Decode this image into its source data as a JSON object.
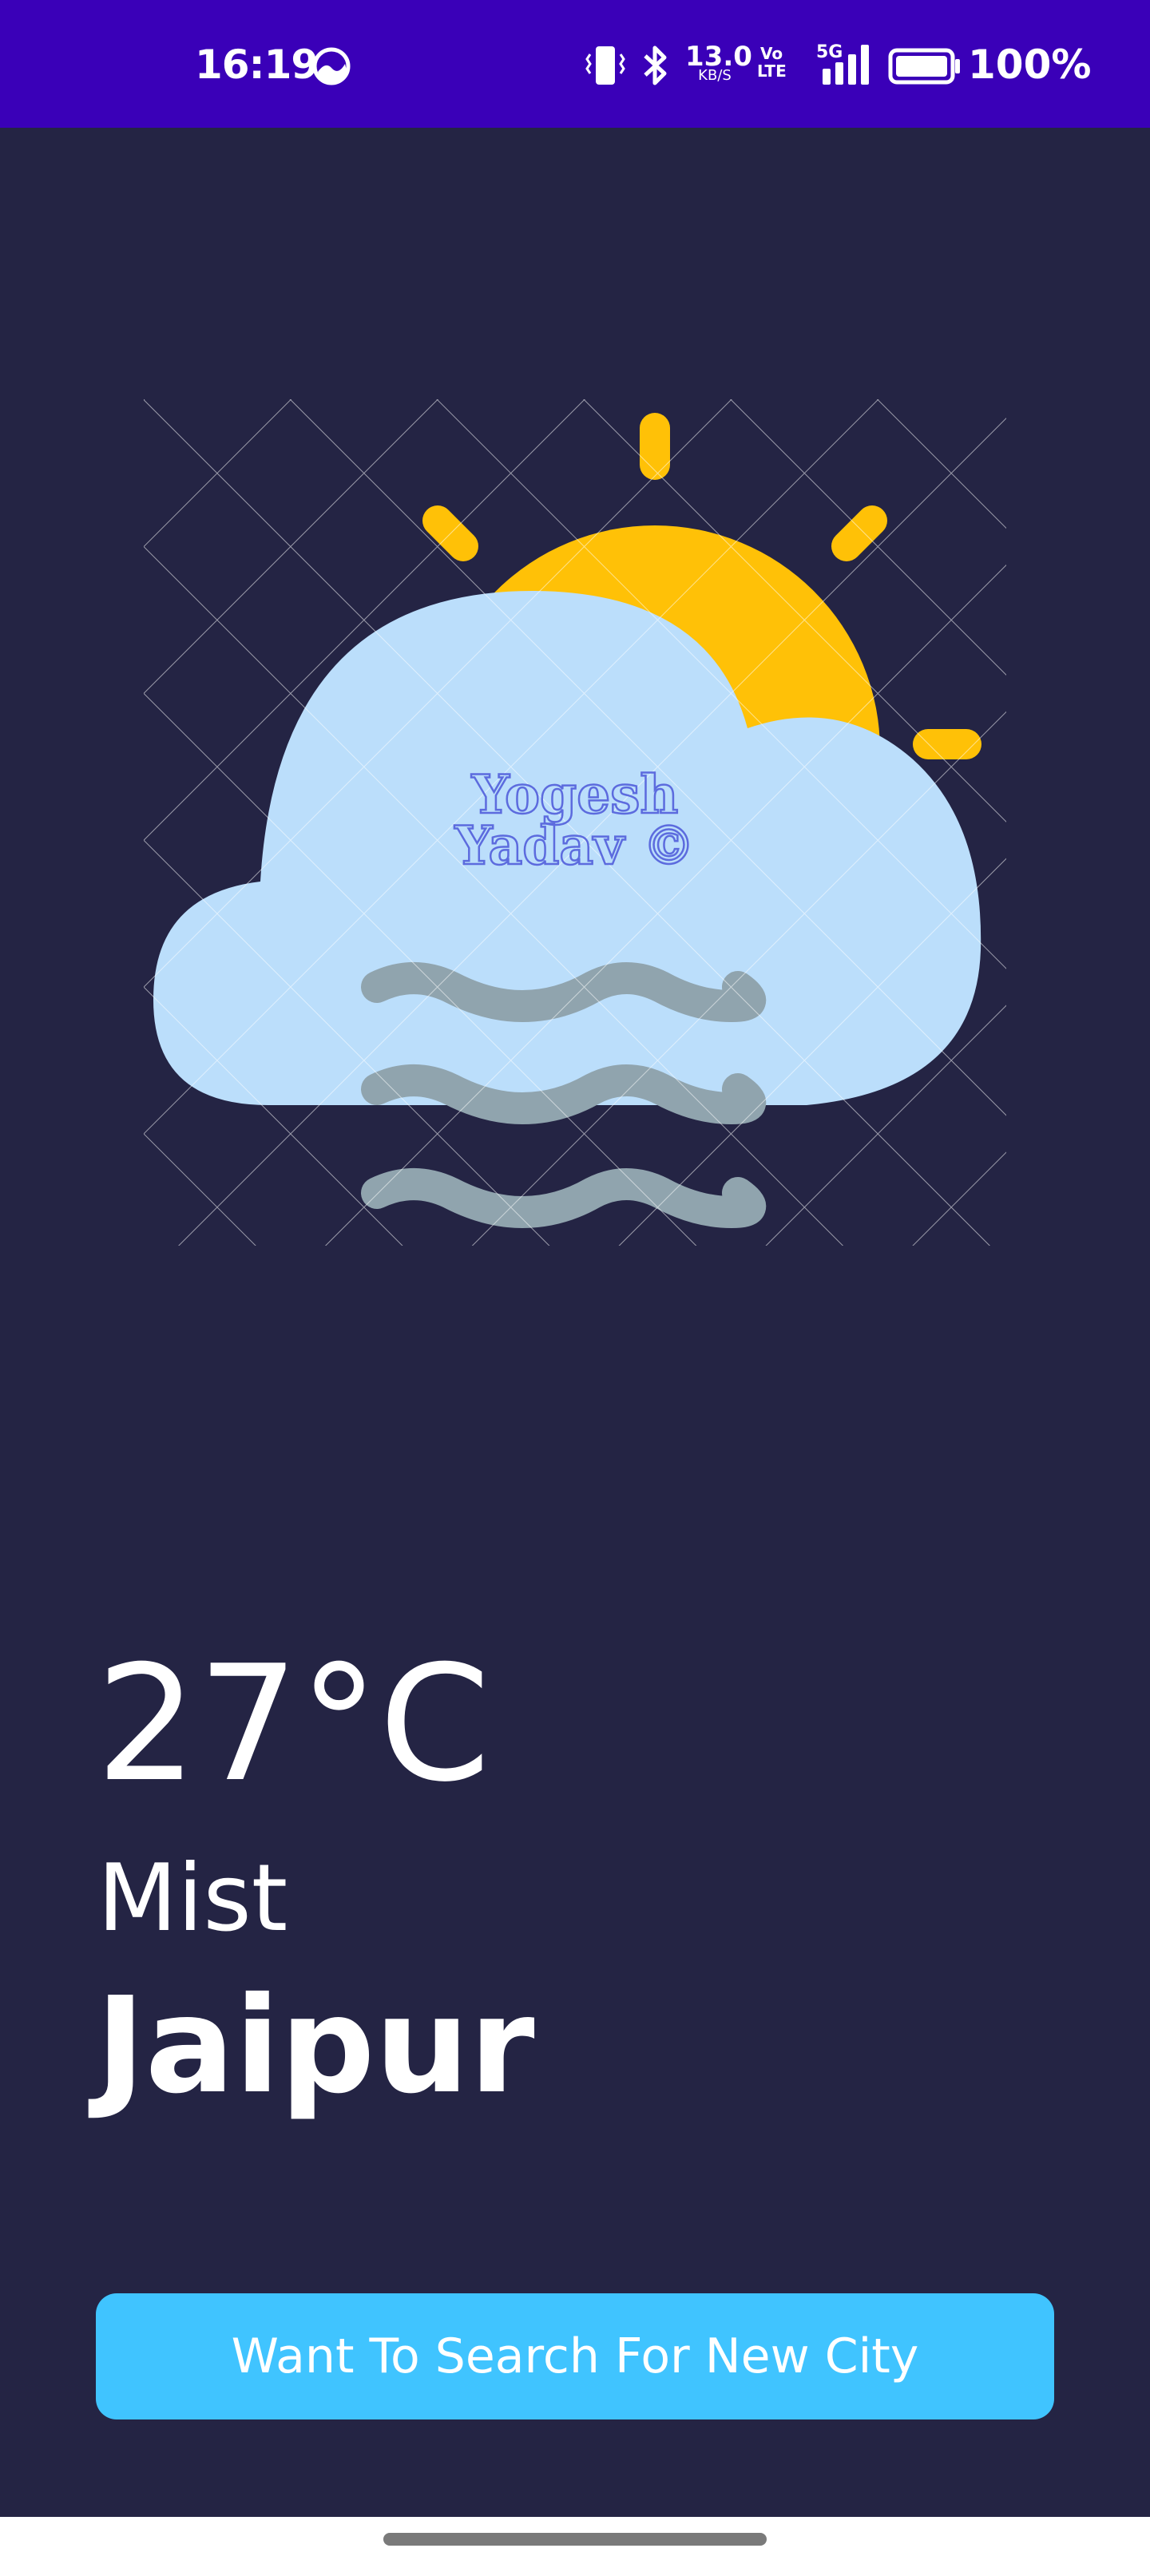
{
  "status_bar": {
    "time": "16:19",
    "net_speed_value": "13.0",
    "net_speed_unit": "KB/S",
    "volte_top": "Vo",
    "volte_bottom": "LTE",
    "network": "5G",
    "battery": "100%",
    "icons": [
      "weather-status-icon",
      "vibrate-icon",
      "bluetooth-icon",
      "signal-icon",
      "battery-icon"
    ]
  },
  "weather": {
    "icon": "sun-behind-cloud-mist-icon",
    "watermark_line1": "Yogesh",
    "watermark_line2": "Yadav ©",
    "temperature": "27°C",
    "condition": "Mist",
    "city": "Jaipur"
  },
  "actions": {
    "search_label": "Want To Search For New City"
  },
  "colors": {
    "status_bar": "#3a00b8",
    "background": "#242444",
    "sun": "#ffc107",
    "cloud": "#bbdefb",
    "mist": "#90a4ae",
    "button": "#40c4ff",
    "watermark": "#5c6bde"
  }
}
